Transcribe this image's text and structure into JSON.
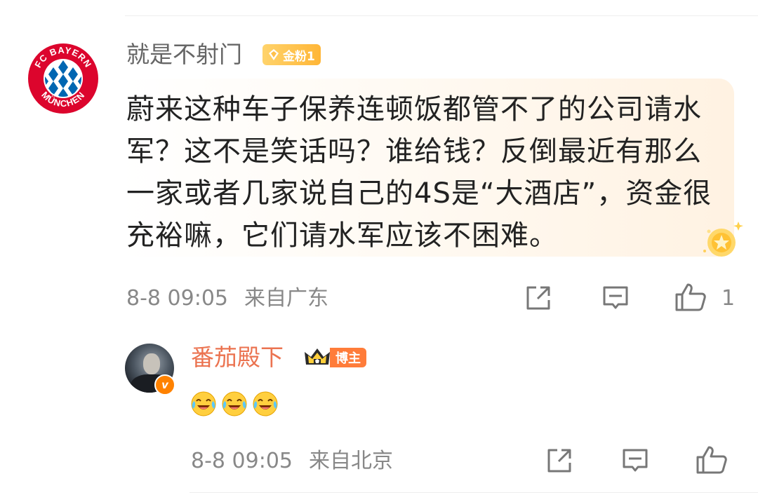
{
  "comment": {
    "author": "就是不射门",
    "fan_badge": "金粉1",
    "avatar_text": {
      "top": "FC BAYERN",
      "bottom": "MÜNCHEN"
    },
    "text": "蔚来这种车子保养连顿饭都管不了的公司请水军？这不是笑话吗？谁给钱？反倒最近有那么一家或者几家说自己的4S是“大酒店”，资金很充裕嘛，它们请水军应该不困难。",
    "time": "8-8 09:05",
    "location": "来自广东",
    "like_count": "1",
    "icons": [
      "share-icon",
      "comment-icon",
      "like-icon",
      "medal-icon"
    ]
  },
  "reply": {
    "author": "番茄殿下",
    "host_badge": "博主",
    "verified_mark": "v",
    "emojis": [
      "laugh-cry-emoji",
      "laugh-cry-emoji",
      "laugh-cry-emoji"
    ],
    "time": "8-8 09:05",
    "location": "来自北京",
    "icons": [
      "share-icon",
      "comment-icon",
      "like-icon"
    ]
  },
  "colors": {
    "reply_name": "#eb7350",
    "host_badge": "#ff7c3a",
    "fan_badge": "#ffb637",
    "meta_text": "#888888"
  }
}
